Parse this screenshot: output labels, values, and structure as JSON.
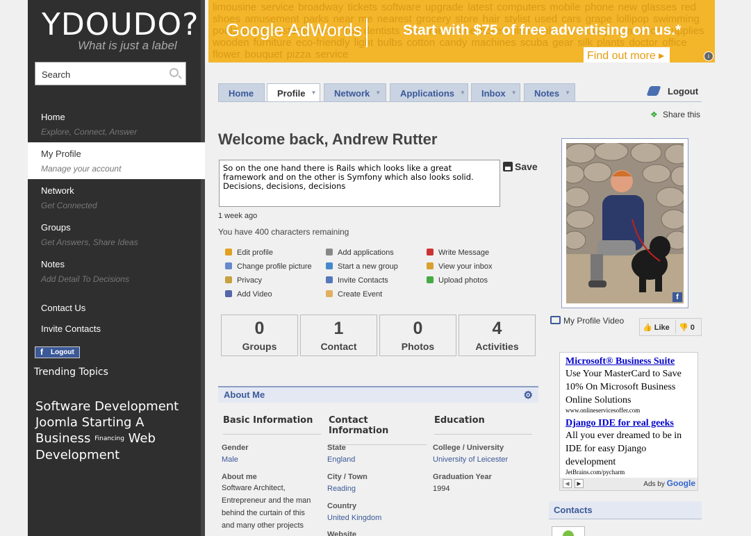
{
  "sidebar": {
    "logo": "YDOUDO?",
    "tagline": "What is just a label",
    "search_value": "Search",
    "nav": [
      {
        "title": "Home",
        "subtitle": "Explore, Connect, Answer"
      },
      {
        "title": "My Profile",
        "subtitle": "Manage your account"
      },
      {
        "title": "Network",
        "subtitle": "Get Connected"
      },
      {
        "title": "Groups",
        "subtitle": "Get Answers, Share Ideas"
      },
      {
        "title": "Notes",
        "subtitle": "Add Detail To Decisions"
      }
    ],
    "contact_us": "Contact Us",
    "invite_contacts": "Invite Contacts",
    "fb_logout": "Logout",
    "trending_title": "Trending Topics",
    "tags": [
      "Software Development",
      "Joomla",
      "Starting A Business",
      "Financing",
      "Web Development"
    ]
  },
  "ad_banner": {
    "background_text": "limousine service broadway tickets software upgrade latest computers mobile phone new glasses red shoes amusement parks near me nearest grocery store hair stylist used cars grape lollipop swimming pools brake systems fresh fruit dentists near me airline tickets fish tanks rainbow pinata office supplies wooden furniture eco-friendly light bulbs cotton candy machines scuba gear silk plants doctor office flower bouquet pizza service",
    "brand": "Google AdWords",
    "offer": "Start with $75 of free advertising on us.*",
    "cta": "Find out more",
    "info": "i"
  },
  "tabs": [
    {
      "label": "Home",
      "arrow": false
    },
    {
      "label": "Profile",
      "arrow": true
    },
    {
      "label": "Network",
      "arrow": true
    },
    {
      "label": "Applications",
      "arrow": true
    },
    {
      "label": "Inbox",
      "arrow": true
    },
    {
      "label": "Notes",
      "arrow": true
    }
  ],
  "top_links": {
    "logout": "Logout",
    "share": "Share this"
  },
  "main": {
    "welcome": "Welcome back, Andrew Rutter",
    "status_text": "So on the one hand there is Rails which looks like a great framework and on the other is Symfony which also looks solid. Decisions, decisions, decisions",
    "save": "Save",
    "status_time": "1 week ago",
    "chars_remaining": "You have 400 characters remaining",
    "actions": [
      {
        "label": "Edit profile",
        "color": "#e0a020"
      },
      {
        "label": "Add applications",
        "color": "#888888"
      },
      {
        "label": "Write Message",
        "color": "#cc3333"
      },
      {
        "label": "Change profile picture",
        "color": "#6688cc"
      },
      {
        "label": "Start a new group",
        "color": "#4488cc"
      },
      {
        "label": "View your inbox",
        "color": "#d9a030"
      },
      {
        "label": "Privacy",
        "color": "#c8a040"
      },
      {
        "label": "Invite Contacts",
        "color": "#5577bb"
      },
      {
        "label": "Upload photos",
        "color": "#44aa44"
      },
      {
        "label": "Add Video",
        "color": "#5566aa"
      },
      {
        "label": "Create Event",
        "color": "#e0b060"
      }
    ],
    "stats": [
      {
        "num": "0",
        "label": "Groups"
      },
      {
        "num": "1",
        "label": "Contact"
      },
      {
        "num": "0",
        "label": "Photos"
      },
      {
        "num": "4",
        "label": "Activities"
      }
    ],
    "about": {
      "title": "About Me",
      "columns": [
        "Basic Information",
        "Contact Information",
        "Education"
      ],
      "basic": [
        {
          "key": "Gender",
          "value": "Male"
        },
        {
          "key": "About me",
          "value": "Software Architect, Entrepreneur and the man behind the curtain of this and many other projects"
        }
      ],
      "contact": [
        {
          "key": "State",
          "value": "England"
        },
        {
          "key": "City / Town",
          "value": "Reading"
        },
        {
          "key": "Country",
          "value": "United Kingdom"
        },
        {
          "key": "Website",
          "value": ""
        }
      ],
      "education": [
        {
          "key": "College / University",
          "value": "University of Leicester"
        },
        {
          "key": "Graduation Year",
          "value": "1994"
        }
      ]
    }
  },
  "right": {
    "video_label": "My Profile Video",
    "like_label": "Like",
    "dislike_count": "0",
    "google_ad": [
      {
        "headline": "Microsoft® Business Suite",
        "body": "Use Your MasterCard to Save 10% On Microsoft Business Online Solutions",
        "url": "www.onlineservicesoffer.com"
      },
      {
        "headline": "Django IDE for real geeks",
        "body": "All you ever dreamed to be in IDE for easy Django development",
        "url": "JetBrains.com/pycharm"
      }
    ],
    "ads_by": "Ads by",
    "ads_brand": "Google",
    "contacts_title": "Contacts"
  }
}
